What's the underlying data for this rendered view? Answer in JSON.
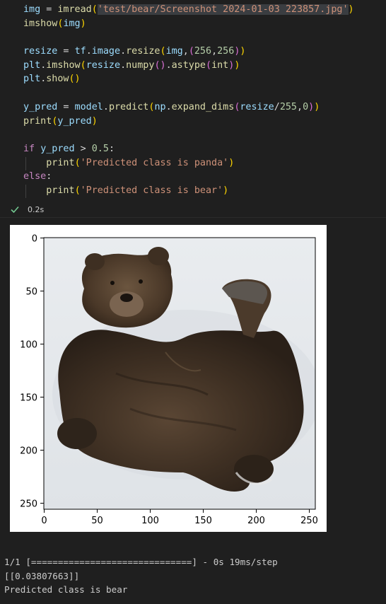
{
  "code_cell": {
    "lines": [
      [
        {
          "t": "img",
          "c": "var"
        },
        {
          "t": " = ",
          "c": "op"
        },
        {
          "t": "imread",
          "c": "fn"
        },
        {
          "t": "(",
          "c": "p1"
        },
        {
          "t": "'test/bear/Screenshot 2024-01-03 223857.jpg'",
          "c": "str",
          "hl": true
        },
        {
          "t": ")",
          "c": "p1"
        }
      ],
      [
        {
          "t": "imshow",
          "c": "fn"
        },
        {
          "t": "(",
          "c": "p1"
        },
        {
          "t": "img",
          "c": "var"
        },
        {
          "t": ")",
          "c": "p1"
        }
      ],
      [],
      [
        {
          "t": "resize",
          "c": "var"
        },
        {
          "t": " = ",
          "c": "op"
        },
        {
          "t": "tf",
          "c": "var"
        },
        {
          "t": ".",
          "c": "op"
        },
        {
          "t": "image",
          "c": "var"
        },
        {
          "t": ".",
          "c": "op"
        },
        {
          "t": "resize",
          "c": "fn"
        },
        {
          "t": "(",
          "c": "p1"
        },
        {
          "t": "img",
          "c": "var"
        },
        {
          "t": ",",
          "c": "op"
        },
        {
          "t": "(",
          "c": "p2"
        },
        {
          "t": "256",
          "c": "num"
        },
        {
          "t": ",",
          "c": "op"
        },
        {
          "t": "256",
          "c": "num"
        },
        {
          "t": ")",
          "c": "p2"
        },
        {
          "t": ")",
          "c": "p1"
        }
      ],
      [
        {
          "t": "plt",
          "c": "var"
        },
        {
          "t": ".",
          "c": "op"
        },
        {
          "t": "imshow",
          "c": "fn"
        },
        {
          "t": "(",
          "c": "p1"
        },
        {
          "t": "resize",
          "c": "var"
        },
        {
          "t": ".",
          "c": "op"
        },
        {
          "t": "numpy",
          "c": "fn"
        },
        {
          "t": "()",
          "c": "p2"
        },
        {
          "t": ".",
          "c": "op"
        },
        {
          "t": "astype",
          "c": "fn"
        },
        {
          "t": "(",
          "c": "p2"
        },
        {
          "t": "int",
          "c": "fn"
        },
        {
          "t": ")",
          "c": "p2"
        },
        {
          "t": ")",
          "c": "p1"
        }
      ],
      [
        {
          "t": "plt",
          "c": "var"
        },
        {
          "t": ".",
          "c": "op"
        },
        {
          "t": "show",
          "c": "fn"
        },
        {
          "t": "()",
          "c": "p1"
        }
      ],
      [],
      [
        {
          "t": "y_pred",
          "c": "var"
        },
        {
          "t": " = ",
          "c": "op"
        },
        {
          "t": "model",
          "c": "var"
        },
        {
          "t": ".",
          "c": "op"
        },
        {
          "t": "predict",
          "c": "fn"
        },
        {
          "t": "(",
          "c": "p1"
        },
        {
          "t": "np",
          "c": "var"
        },
        {
          "t": ".",
          "c": "op"
        },
        {
          "t": "expand_dims",
          "c": "fn"
        },
        {
          "t": "(",
          "c": "p2"
        },
        {
          "t": "resize",
          "c": "var"
        },
        {
          "t": "/",
          "c": "op"
        },
        {
          "t": "255",
          "c": "num"
        },
        {
          "t": ",",
          "c": "op"
        },
        {
          "t": "0",
          "c": "num"
        },
        {
          "t": ")",
          "c": "p2"
        },
        {
          "t": ")",
          "c": "p1"
        }
      ],
      [
        {
          "t": "print",
          "c": "fn"
        },
        {
          "t": "(",
          "c": "p1"
        },
        {
          "t": "y_pred",
          "c": "var"
        },
        {
          "t": ")",
          "c": "p1"
        }
      ],
      [],
      [
        {
          "t": "if",
          "c": "kw"
        },
        {
          "t": " ",
          "c": "op"
        },
        {
          "t": "y_pred",
          "c": "var"
        },
        {
          "t": " > ",
          "c": "op"
        },
        {
          "t": "0.5",
          "c": "num"
        },
        {
          "t": ":",
          "c": "op"
        }
      ],
      [
        {
          "t": "    ",
          "c": "op"
        },
        {
          "t": "print",
          "c": "fn"
        },
        {
          "t": "(",
          "c": "p1"
        },
        {
          "t": "'Predicted class is panda'",
          "c": "str"
        },
        {
          "t": ")",
          "c": "p1"
        }
      ],
      [
        {
          "t": "else",
          "c": "kw"
        },
        {
          "t": ":",
          "c": "op"
        }
      ],
      [
        {
          "t": "    ",
          "c": "op"
        },
        {
          "t": "print",
          "c": "fn"
        },
        {
          "t": "(",
          "c": "p1"
        },
        {
          "t": "'Predicted class is bear'",
          "c": "str"
        },
        {
          "t": ")",
          "c": "p1"
        }
      ]
    ]
  },
  "execution": {
    "status_icon": "check-icon",
    "status_color": "#73c991",
    "time": "0.2s"
  },
  "plot": {
    "image_subject": "brown bear lying on its back in snow, waving a paw",
    "y_ticks": [
      "0",
      "50",
      "100",
      "150",
      "200",
      "250"
    ],
    "x_ticks": [
      "0",
      "50",
      "100",
      "150",
      "200",
      "250"
    ],
    "xlim": [
      0,
      256
    ],
    "ylim": [
      0,
      256
    ]
  },
  "output": {
    "progress_line": "1/1 [==============================] - 0s 19ms/step",
    "prediction_array": "[[0.03807663]]",
    "result_line": "Predicted class is bear"
  },
  "theme": {
    "background": "#1f1f1f",
    "string_highlight": "#3a3d41"
  }
}
